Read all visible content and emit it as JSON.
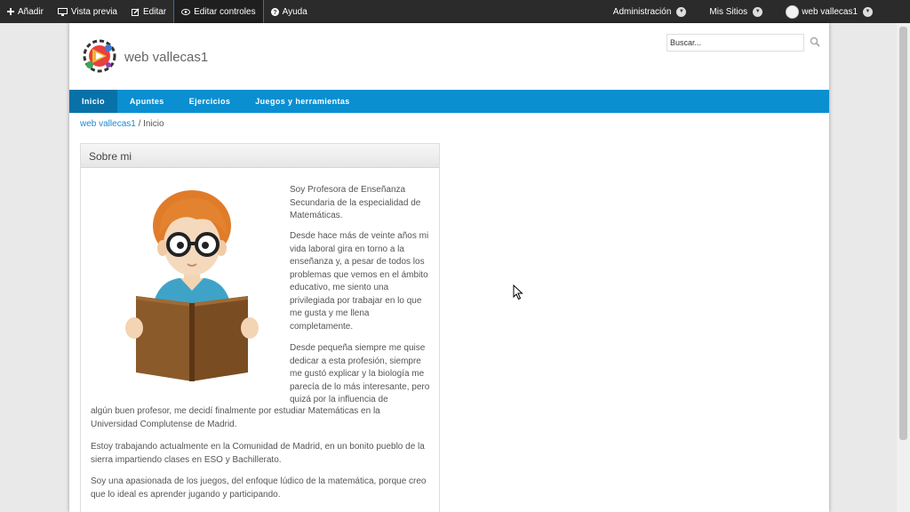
{
  "adminbar": {
    "add": "Añadir",
    "preview": "Vista previa",
    "edit": "Editar",
    "edit_controls": "Editar controles",
    "help": "Ayuda",
    "administration": "Administración",
    "my_sites": "Mis Sitios",
    "user": "web vallecas1"
  },
  "header": {
    "site_title": "web vallecas1",
    "search_value": "Buscar..."
  },
  "nav": [
    "Inicio",
    "Apuntes",
    "Ejercicios",
    "Juegos y herramientas"
  ],
  "breadcrumb": {
    "root": "web vallecas1",
    "separator": "/",
    "current": "Inicio"
  },
  "portlet": {
    "title": "Sobre mi",
    "paragraphs": [
      "Soy Profesora de Enseñanza Secundaria de la especialidad de Matemáticas.",
      "Desde hace más de veinte años mi vida laboral gira en torno a la enseñanza y, a pesar de todos los problemas que vemos en el ámbito educativo, me siento una privilegiada por trabajar en lo que me gusta y me llena completamente.",
      "Desde pequeña siempre me quise dedicar a esta profesión, siempre me gustó explicar y la biología me parecía de lo más interesante, pero quizá por la influencia de",
      "algún buen profesor, me decidí finalmente por estudiar Matemáticas en la Universidad Complutense de Madrid.",
      "Estoy trabajando actualmente en la Comunidad de Madrid, en un bonito pueblo de la sierra impartiendo clases en ESO y Bachillerato.",
      "Soy una apasionada de los juegos, del enfoque lúdico de la matemática, porque creo que lo ideal es aprender jugando y participando."
    ]
  },
  "colors": {
    "adminbar": "#2b2b2b",
    "nav": "#0a8fd1",
    "nav_active": "#0872a8",
    "link": "#1a8bd1"
  },
  "icons": [
    "plus-icon",
    "monitor-icon",
    "edit-icon",
    "eye-icon",
    "help-icon",
    "chevron-down-icon",
    "search-icon",
    "cursor-icon"
  ]
}
